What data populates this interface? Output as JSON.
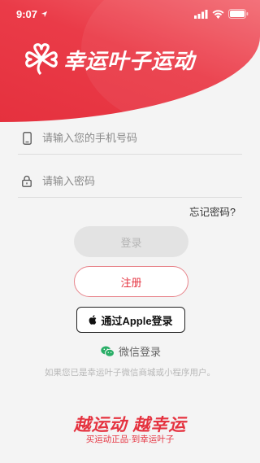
{
  "status_bar": {
    "time": "9:07",
    "icons": [
      "location-arrow-icon",
      "cell-signal-icon",
      "wifi-icon",
      "battery-icon"
    ]
  },
  "brand": {
    "logo_icon": "four-leaf-clover-icon",
    "name": "幸运叶子运动",
    "accent_color": "#e5323f"
  },
  "form": {
    "phone": {
      "placeholder": "请输入您的手机号码",
      "value": "",
      "icon": "phone-icon"
    },
    "password": {
      "placeholder": "请输入密码",
      "value": "",
      "icon": "lock-icon"
    },
    "forgot_label": "忘记密码?"
  },
  "buttons": {
    "login_label": "登录",
    "register_label": "注册",
    "apple_label": "通过Apple登录",
    "wechat_label": "微信登录"
  },
  "hint_text": "如果您已是幸运叶子微信商城或小程序用户。",
  "footer": {
    "slogan": "越运动 越幸运",
    "subtitle": "买运动正品·到幸运叶子"
  }
}
